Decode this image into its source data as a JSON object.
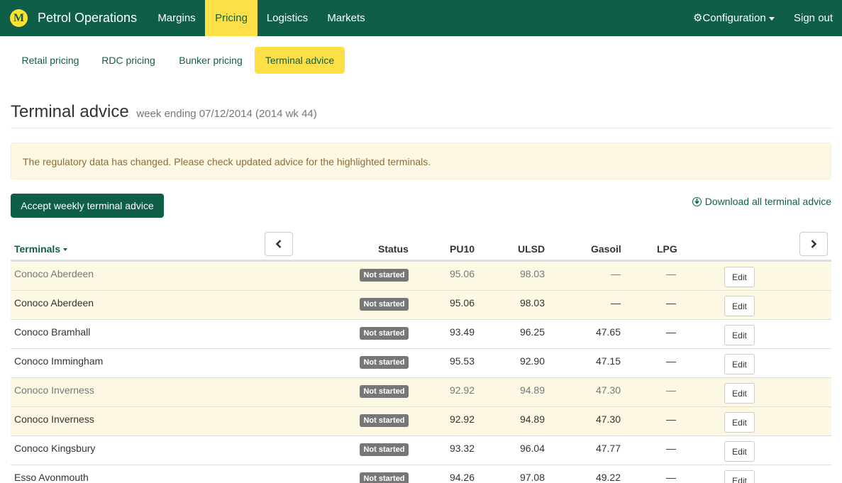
{
  "app": {
    "logo_letter": "M",
    "title": "Petrol Operations",
    "nav": [
      "Margins",
      "Pricing",
      "Logistics",
      "Markets"
    ],
    "active_nav": "Pricing",
    "configuration_label": "Configuration",
    "signout_label": "Sign out"
  },
  "subnav": [
    "Retail pricing",
    "RDC pricing",
    "Bunker pricing",
    "Terminal advice"
  ],
  "page": {
    "title": "Terminal advice",
    "subtitle": "week ending 07/12/2014 (2014 wk 44)",
    "alert": "The regulatory data has changed. Please check updated advice for the highlighted terminals.",
    "accept_label": "Accept weekly terminal advice",
    "download_label": "Download all terminal advice"
  },
  "table": {
    "headers": {
      "terminals": "Terminals",
      "status": "Status",
      "pu10": "PU10",
      "ulsd": "ULSD",
      "gasoil": "Gasoil",
      "lpg": "LPG"
    },
    "edit_label": "Edit",
    "rows": [
      {
        "name": "Conoco Aberdeen",
        "status": "Not started",
        "pu10": "95.06",
        "ulsd": "98.03",
        "gasoil": "—",
        "lpg": "—",
        "highlight": true,
        "muted": true
      },
      {
        "name": "Conoco Aberdeen",
        "status": "Not started",
        "pu10": "95.06",
        "ulsd": "98.03",
        "gasoil": "—",
        "lpg": "—",
        "highlight": true,
        "muted": false
      },
      {
        "name": "Conoco Bramhall",
        "status": "Not started",
        "pu10": "93.49",
        "ulsd": "96.25",
        "gasoil": "47.65",
        "lpg": "—",
        "highlight": false,
        "muted": false
      },
      {
        "name": "Conoco Immingham",
        "status": "Not started",
        "pu10": "95.53",
        "ulsd": "92.90",
        "gasoil": "47.15",
        "lpg": "—",
        "highlight": false,
        "muted": false
      },
      {
        "name": "Conoco Inverness",
        "status": "Not started",
        "pu10": "92.92",
        "ulsd": "94.89",
        "gasoil": "47.30",
        "lpg": "—",
        "highlight": true,
        "muted": true
      },
      {
        "name": "Conoco Inverness",
        "status": "Not started",
        "pu10": "92.92",
        "ulsd": "94.89",
        "gasoil": "47.30",
        "lpg": "—",
        "highlight": true,
        "muted": false
      },
      {
        "name": "Conoco Kingsbury",
        "status": "Not started",
        "pu10": "93.32",
        "ulsd": "96.04",
        "gasoil": "47.77",
        "lpg": "—",
        "highlight": false,
        "muted": false
      },
      {
        "name": "Esso Avonmouth",
        "status": "Not started",
        "pu10": "94.26",
        "ulsd": "97.08",
        "gasoil": "49.22",
        "lpg": "—",
        "highlight": false,
        "muted": false
      }
    ]
  }
}
